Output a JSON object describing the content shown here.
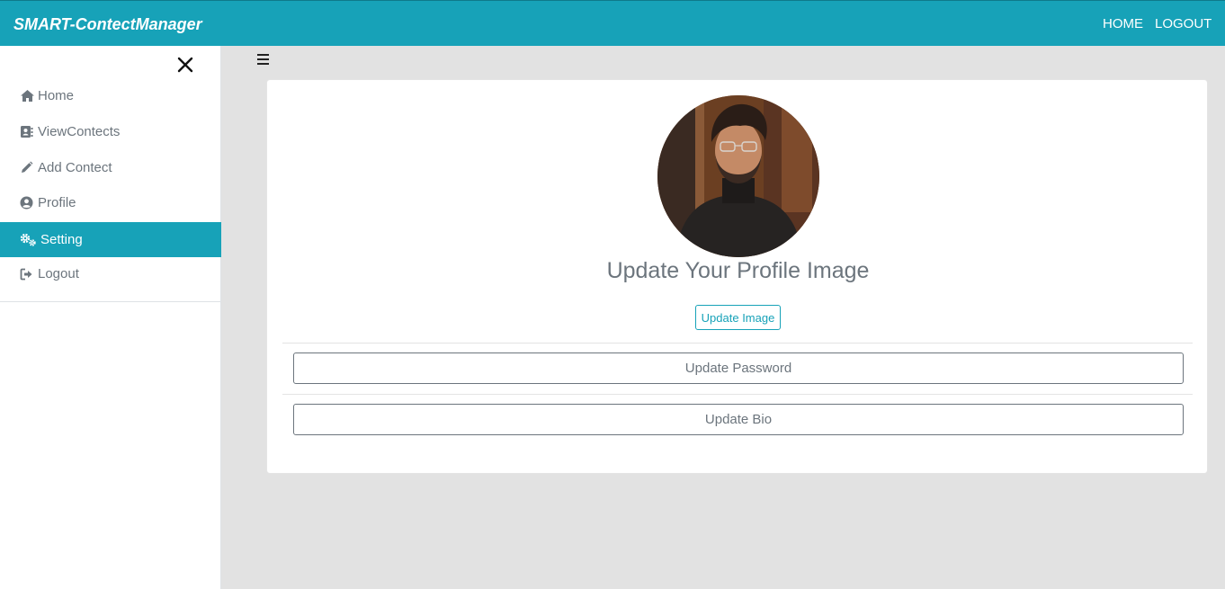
{
  "navbar": {
    "brand": "SMART-ContectManager",
    "links": {
      "home": "HOME",
      "logout": "LOGOUT"
    }
  },
  "sidebar": {
    "items": [
      {
        "label": "Home",
        "icon": "home-icon"
      },
      {
        "label": "ViewContects",
        "icon": "address-book-icon"
      },
      {
        "label": "Add Contect",
        "icon": "pencil-icon"
      },
      {
        "label": "Profile",
        "icon": "user-circle-icon"
      },
      {
        "label": "Setting",
        "icon": "cogs-icon",
        "active": true
      },
      {
        "label": "Logout",
        "icon": "sign-out-icon"
      }
    ]
  },
  "main": {
    "title": "Update Your Profile Image",
    "update_image_label": "Update Image",
    "update_password_label": "Update Password",
    "update_bio_label": "Update Bio"
  },
  "colors": {
    "accent": "#17a2b8",
    "muted_text": "#6c757d",
    "background": "#e2e2e2"
  }
}
